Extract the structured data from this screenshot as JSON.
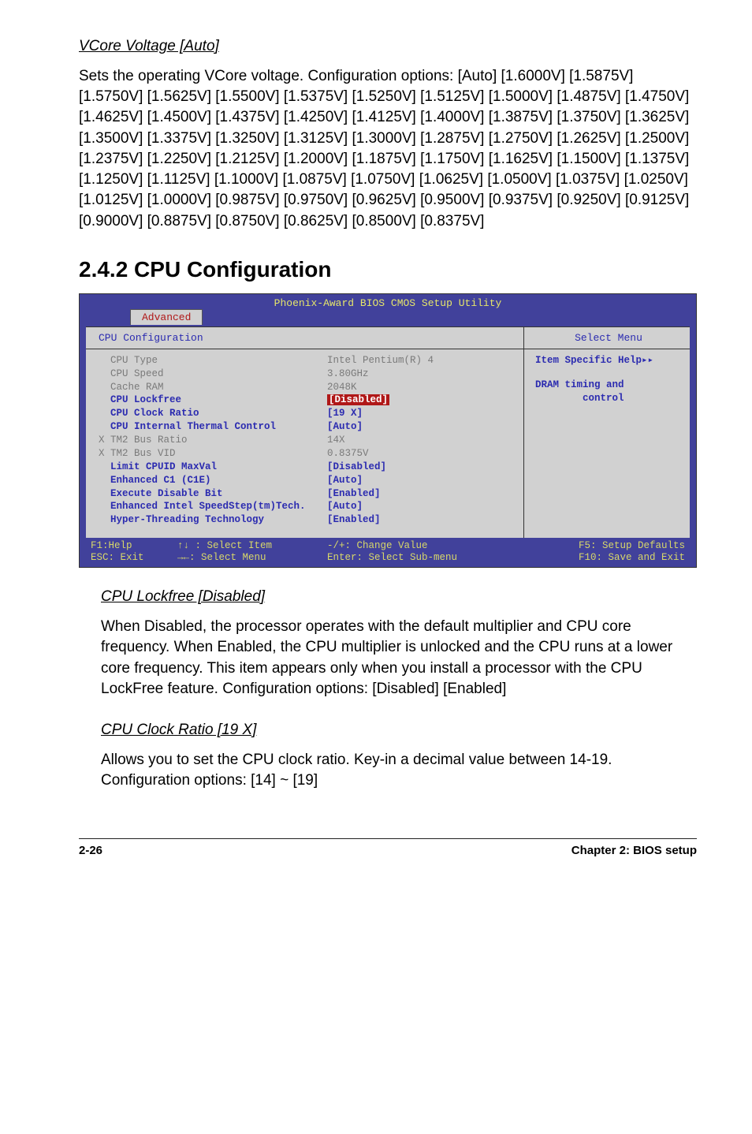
{
  "section1": {
    "heading": "VCore Voltage [Auto]",
    "body": "Sets the operating VCore voltage. Configuration options: [Auto] [1.6000V] [1.5875V] [1.5750V] [1.5625V] [1.5500V] [1.5375V] [1.5250V] [1.5125V] [1.5000V] [1.4875V] [1.4750V] [1.4625V] [1.4500V] [1.4375V] [1.4250V] [1.4125V] [1.4000V] [1.3875V] [1.3750V] [1.3625V] [1.3500V] [1.3375V] [1.3250V] [1.3125V] [1.3000V] [1.2875V] [1.2750V] [1.2625V] [1.2500V] [1.2375V] [1.2250V] [1.2125V] [1.2000V] [1.1875V] [1.1750V] [1.1625V] [1.1500V] [1.1375V] [1.1250V] [1.1125V] [1.1000V] [1.0875V] [1.0750V] [1.0625V] [1.0500V] [1.0375V] [1.0250V] [1.0125V] [1.0000V] [0.9875V] [0.9750V] [0.9625V] [0.9500V] [0.9375V] [0.9250V] [0.9125V] [0.9000V] [0.8875V] [0.8750V] [0.8625V] [0.8500V] [0.8375V]"
  },
  "main_heading": "2.4.2   CPU Configuration",
  "bios": {
    "title": "Phoenix-Award BIOS CMOS Setup Utility",
    "tab": "Advanced",
    "panel_title": "CPU Configuration",
    "select_menu": "Select Menu",
    "help_title": "Item Specific Help▸▸",
    "help_body1": "DRAM timing and",
    "help_body2": "        control",
    "rows": [
      {
        "label": "CPU Type",
        "value": "Intel Pentium(R) 4",
        "cls": "dim"
      },
      {
        "label": "CPU Speed",
        "value": "3.80GHz",
        "cls": "dim"
      },
      {
        "label": "Cache RAM",
        "value": "2048K",
        "cls": "dim"
      },
      {
        "label": "CPU Lockfree",
        "value": "[Disabled]",
        "cls": "editable",
        "hl": true
      },
      {
        "label": "CPU Clock Ratio",
        "value": "[19 X]",
        "cls": "editable"
      },
      {
        "label": "CPU Internal Thermal Control",
        "value": "[Auto]",
        "cls": "editable"
      },
      {
        "label": "X TM2 Bus Ratio",
        "value": "14X",
        "cls": "dim",
        "outdent": true
      },
      {
        "label": "X TM2 Bus VID",
        "value": "0.8375V",
        "cls": "dim",
        "outdent": true
      },
      {
        "label": "Limit CPUID MaxVal",
        "value": "[Disabled]",
        "cls": "editable"
      },
      {
        "label": "Enhanced C1 (C1E)",
        "value": "[Auto]",
        "cls": "editable"
      },
      {
        "label": "Execute Disable Bit",
        "value": "[Enabled]",
        "cls": "editable"
      },
      {
        "label": "Enhanced Intel SpeedStep(tm)Tech.",
        "value": "[Auto]",
        "cls": "editable"
      },
      {
        "label": "Hyper-Threading Technology",
        "value": "[Enabled]",
        "cls": "editable"
      }
    ],
    "footer": {
      "f1": "F1:Help",
      "sel_item": "↑↓ : Select Item",
      "change": "-/+: Change Value",
      "defaults": "F5: Setup Defaults",
      "esc": "ESC: Exit",
      "sel_menu": "→←: Select Menu",
      "enter": "Enter: Select Sub-menu",
      "save": "F10: Save and Exit"
    }
  },
  "section2": {
    "heading": "CPU Lockfree [Disabled]",
    "body": "When Disabled, the processor operates with the default multiplier and CPU core frequency. When Enabled, the CPU multiplier is unlocked and the CPU runs at a lower core frequency. This item appears only when you install a processor with the CPU LockFree feature. Configuration options: [Disabled] [Enabled]"
  },
  "section3": {
    "heading": "CPU Clock Ratio [19 X]",
    "body1": "Allows you to set the CPU clock ratio. Key-in a decimal value between 14-19.",
    "body2": "Configuration options: [14] ~ [19]"
  },
  "footer": {
    "left": "2-26",
    "right": "Chapter 2: BIOS setup"
  }
}
